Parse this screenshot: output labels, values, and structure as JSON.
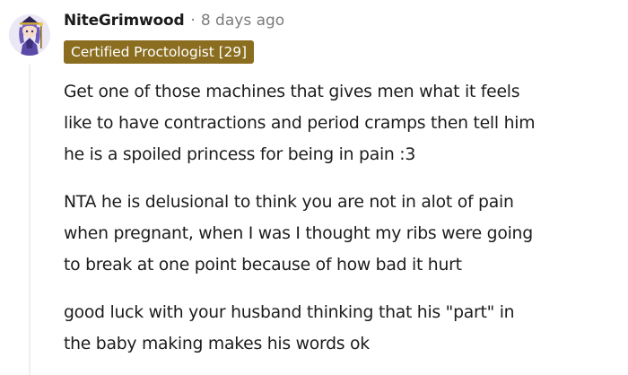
{
  "comment": {
    "username": "NiteGrimwood",
    "separator": "·",
    "timestamp": "8 days ago",
    "flair": "Certified Proctologist [29]",
    "paragraphs": [
      {
        "lines": [
          "Get one of those machines that gives men what it feels",
          "like to have contractions and period cramps then tell him",
          "he is a spoiled princess for being in pain :3"
        ]
      },
      {
        "lines": [
          "NTA he is delusional to think you are not in alot of pain",
          "when pregnant, when I was I thought my ribs were going",
          "to break at one point because of how bad it hurt"
        ]
      },
      {
        "lines": [
          "good luck with your husband thinking that his \"part\" in",
          "the baby making makes his words ok"
        ]
      }
    ]
  },
  "colors": {
    "flair_background": "#8a6d1f",
    "flair_text": "#ffffff",
    "username": "#1c1c1c",
    "meta_text": "#7c7c7c",
    "thread_line": "#edeff1"
  },
  "icons": {
    "avatar": "user-avatar-anime-character"
  }
}
